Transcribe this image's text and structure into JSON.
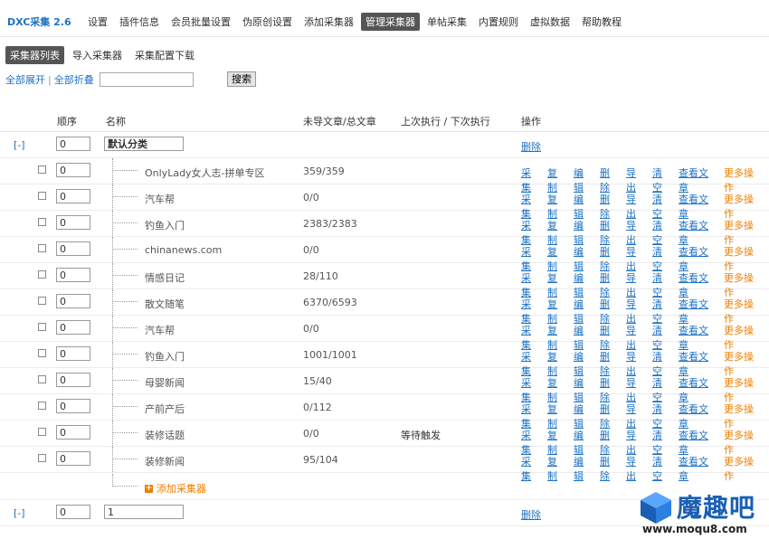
{
  "app": {
    "brand": "DXC采集 2.6"
  },
  "nav": [
    {
      "label": "设置"
    },
    {
      "label": "插件信息"
    },
    {
      "label": "会员批量设置"
    },
    {
      "label": "伪原创设置"
    },
    {
      "label": "添加采集器"
    },
    {
      "label": "管理采集器",
      "active": true
    },
    {
      "label": "单帖采集"
    },
    {
      "label": "内置规则"
    },
    {
      "label": "虚拟数据"
    },
    {
      "label": "帮助教程"
    }
  ],
  "subtabs": [
    {
      "label": "采集器列表",
      "active": true
    },
    {
      "label": "导入采集器"
    },
    {
      "label": "采集配置下载"
    }
  ],
  "toolbar": {
    "expand_all": "全部展开",
    "separator": "|",
    "collapse_all": "全部折叠",
    "search_value": "",
    "search_button": "搜索"
  },
  "table": {
    "headers": {
      "order": "顺序",
      "name": "名称",
      "count": "未导文章/总文章",
      "exec": "上次执行 / 下次执行",
      "ops": "操作"
    },
    "category1": {
      "toggle": "[-]",
      "order": "0",
      "name": "默认分类",
      "delete": "删除"
    },
    "rows": [
      {
        "order": "0",
        "name": "OnlyLady女人志-拼单专区",
        "count": "359/359",
        "status": ""
      },
      {
        "order": "0",
        "name": "汽车帮",
        "count": "0/0",
        "status": ""
      },
      {
        "order": "0",
        "name": "钓鱼入门",
        "count": "2383/2383",
        "status": ""
      },
      {
        "order": "0",
        "name": "chinanews.com",
        "count": "0/0",
        "status": ""
      },
      {
        "order": "0",
        "name": "情感日记",
        "count": "28/110",
        "status": ""
      },
      {
        "order": "0",
        "name": "散文随笔",
        "count": "6370/6593",
        "status": ""
      },
      {
        "order": "0",
        "name": "汽车帮",
        "count": "0/0",
        "status": ""
      },
      {
        "order": "0",
        "name": "钓鱼入门",
        "count": "1001/1001",
        "status": ""
      },
      {
        "order": "0",
        "name": "母婴新闻",
        "count": "15/40",
        "status": ""
      },
      {
        "order": "0",
        "name": "产前产后",
        "count": "0/112",
        "status": ""
      },
      {
        "order": "0",
        "name": "装修话题",
        "count": "0/0",
        "status": "等待触发"
      },
      {
        "order": "0",
        "name": "装修新闻",
        "count": "95/104",
        "status": ""
      }
    ],
    "row_ops": [
      "采集",
      "复制",
      "编辑",
      "删除",
      "导出",
      "清空",
      "查看文章",
      "更多操作"
    ],
    "add_collector": "添加采集器",
    "category2": {
      "toggle": "[-]",
      "order": "0",
      "name": "1",
      "delete": "删除"
    }
  },
  "watermark": {
    "title": "魔趣吧",
    "url": "www.moqu8.com"
  },
  "colors": {
    "link": "#1d72c4",
    "more": "#f07d00",
    "active_tab_bg": "#555555"
  }
}
